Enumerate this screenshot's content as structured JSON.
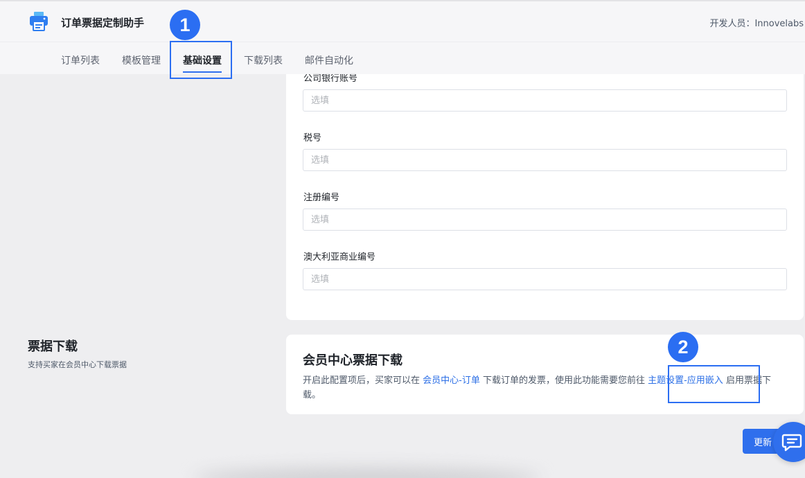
{
  "header": {
    "app_title": "订单票据定制助手",
    "developer": "开发人员：Innovelabs"
  },
  "tabs": [
    {
      "label": "订单列表"
    },
    {
      "label": "模板管理"
    },
    {
      "label": "基础设置",
      "active": true
    },
    {
      "label": "下载列表"
    },
    {
      "label": "邮件自动化"
    }
  ],
  "form": {
    "fields": [
      {
        "label": "公司银行账号",
        "placeholder": "选填",
        "value": ""
      },
      {
        "label": "税号",
        "placeholder": "选填",
        "value": ""
      },
      {
        "label": "注册编号",
        "placeholder": "选填",
        "value": ""
      },
      {
        "label": "澳大利亚商业编号",
        "placeholder": "选填",
        "value": ""
      }
    ]
  },
  "download_section": {
    "title": "票据下载",
    "subtitle": "支持买家在会员中心下载票据",
    "card_title": "会员中心票据下载",
    "desc_part1": "开启此配置项后，买家可以在 ",
    "link1": "会员中心-订单",
    "desc_part2": " 下载订单的发票，使用此功能需要您前往 ",
    "link2": "主题设置-应用嵌入",
    "desc_part3": " 启用票据下载。"
  },
  "actions": {
    "update_label": "更新"
  },
  "annotations": {
    "badge1": "1",
    "badge2": "2"
  },
  "colors": {
    "accent": "#2f6fed",
    "link": "#2c6fe6",
    "annotation": "#2b6ef2",
    "background": "#eeeef0"
  },
  "icons": [
    "printer-icon",
    "chat-icon"
  ]
}
